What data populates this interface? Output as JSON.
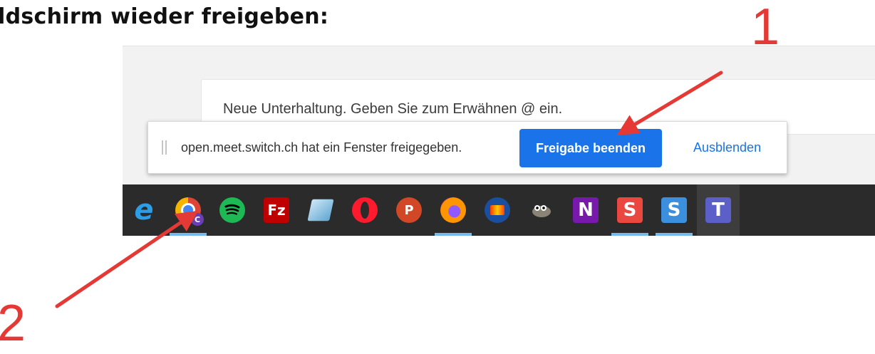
{
  "heading": "ldschirm wieder freigeben:",
  "chat": {
    "placeholder": "Neue Unterhaltung. Geben Sie zum Erwähnen @ ein."
  },
  "share_bar": {
    "message": "open.meet.switch.ch hat ein Fenster freigegeben.",
    "stop_label": "Freigabe beenden",
    "hide_label": "Ausblenden"
  },
  "annotations": {
    "label_1": "1",
    "label_2": "2",
    "arrow_color": "#e53935"
  },
  "taskbar": {
    "items": [
      {
        "name": "internet-explorer-icon",
        "glyph": "e",
        "bg": "transparent",
        "fg": "#2b9ee8",
        "shape": "plain",
        "active": false,
        "underline": false
      },
      {
        "name": "chrome-icon",
        "glyph": "",
        "bg": "chrome",
        "fg": "#ffffff",
        "shape": "chrome",
        "active": false,
        "underline": true,
        "badge": "C"
      },
      {
        "name": "spotify-icon",
        "glyph": "",
        "bg": "#1db954",
        "fg": "#000000",
        "shape": "spotify",
        "active": false,
        "underline": false
      },
      {
        "name": "filezilla-icon",
        "glyph": "Fz",
        "bg": "#bf0000",
        "fg": "#ffffff",
        "shape": "square",
        "active": false,
        "underline": false
      },
      {
        "name": "notepad-icon",
        "glyph": "",
        "bg": "#8fc3e0",
        "fg": "#ffffff",
        "shape": "notepad",
        "active": false,
        "underline": false
      },
      {
        "name": "opera-icon",
        "glyph": "",
        "bg": "#ff1b2d",
        "fg": "#2b2b2b",
        "shape": "opera",
        "active": false,
        "underline": false
      },
      {
        "name": "powerpoint-icon",
        "glyph": "P",
        "bg": "#d24726",
        "fg": "#ffffff",
        "shape": "round",
        "active": false,
        "underline": false
      },
      {
        "name": "firefox-icon",
        "glyph": "",
        "bg": "#ff9500",
        "fg": "#ffffff",
        "shape": "firefox",
        "active": false,
        "underline": true
      },
      {
        "name": "audacity-icon",
        "glyph": "",
        "bg": "#1a4fa0",
        "fg": "#ff7a00",
        "shape": "audacity",
        "active": false,
        "underline": false
      },
      {
        "name": "gimp-icon",
        "glyph": "",
        "bg": "#6e6a5e",
        "fg": "#ffffff",
        "shape": "gimp",
        "active": false,
        "underline": false
      },
      {
        "name": "onenote-icon",
        "glyph": "N",
        "bg": "#7719aa",
        "fg": "#ffffff",
        "shape": "square",
        "active": false,
        "underline": false
      },
      {
        "name": "sublime-red-icon",
        "glyph": "S",
        "bg": "#e9473f",
        "fg": "#ffffff",
        "shape": "square",
        "active": false,
        "underline": true
      },
      {
        "name": "sublime-blue-icon",
        "glyph": "S",
        "bg": "#3b8fdc",
        "fg": "#ffffff",
        "shape": "square",
        "active": false,
        "underline": true
      },
      {
        "name": "teams-icon",
        "glyph": "T",
        "bg": "#5b5fc7",
        "fg": "#ffffff",
        "shape": "square",
        "active": true,
        "underline": false
      }
    ]
  }
}
